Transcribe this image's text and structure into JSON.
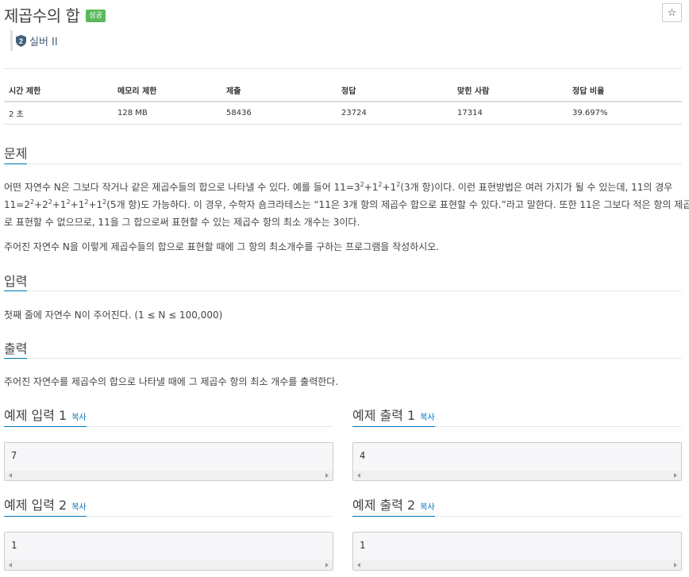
{
  "problem": {
    "title": "제곱수의 합",
    "badge": "성공",
    "star_icon": "☆",
    "tier_number": "2",
    "tier_label": "실버 II"
  },
  "stats": {
    "headers": [
      "시간 제한",
      "메모리 제한",
      "제출",
      "정답",
      "맞힌 사람",
      "정답 비율"
    ],
    "values": [
      "2 초",
      "128 MB",
      "58436",
      "23724",
      "17314",
      "39.697%"
    ]
  },
  "sections": {
    "description_title": "문제",
    "description": {
      "p1_a": "어떤 자연수 N은 그보다 작거나 같은 제곱수들의 합으로 나타낼 수 있다. 예를 들어 11=3",
      "p1_sup1": "2",
      "p1_b": "+1",
      "p1_sup2": "2",
      "p1_c": "+1",
      "p1_sup3": "2",
      "p1_d": "(3개 항)이다. 이런 표현방법은 여러 가지가 될 수 있는데, 11의 경우",
      "p1_e": "11=2",
      "p1_sup4": "2",
      "p1_f": "+2",
      "p1_sup5": "2",
      "p1_g": "+1",
      "p1_sup6": "2",
      "p1_h": "+1",
      "p1_sup7": "2",
      "p1_i": "+1",
      "p1_sup8": "2",
      "p1_j": "(5개 항)도 가능하다. 이 경우, 수학자 숌크라테스는 “11은 3개 항의 제곱수 합으로 표현할 수 있다.”라고 말한다. 또한 11은 그보다 적은 항의 제곱수 합으",
      "p1_k": "로 표현할 수 없으므로, 11을 그 합으로써 표현할 수 있는 제곱수 항의 최소 개수는 3이다.",
      "p2": "주어진 자연수 N을 이렇게 제곱수들의 합으로 표현할 때에 그 항의 최소개수를 구하는 프로그램을 작성하시오."
    },
    "input_title": "입력",
    "input_text": "첫째 줄에 자연수 N이 주어진다. (1 ≤ N ≤ 100,000)",
    "output_title": "출력",
    "output_text": "주어진 자연수를 제곱수의 합으로 나타낼 때에 그 제곱수 항의 최소 개수를 출력한다."
  },
  "examples": {
    "copy_label": "복사",
    "in1_title": "예제 입력 1",
    "in1_value": "7",
    "out1_title": "예제 출력 1",
    "out1_value": "4",
    "in2_title": "예제 입력 2",
    "in2_value": "1",
    "out2_title": "예제 출력 2",
    "out2_value": "1"
  },
  "colors": {
    "accent": "#0076c0",
    "success": "#5cb85c",
    "tier": "#435f7a"
  }
}
